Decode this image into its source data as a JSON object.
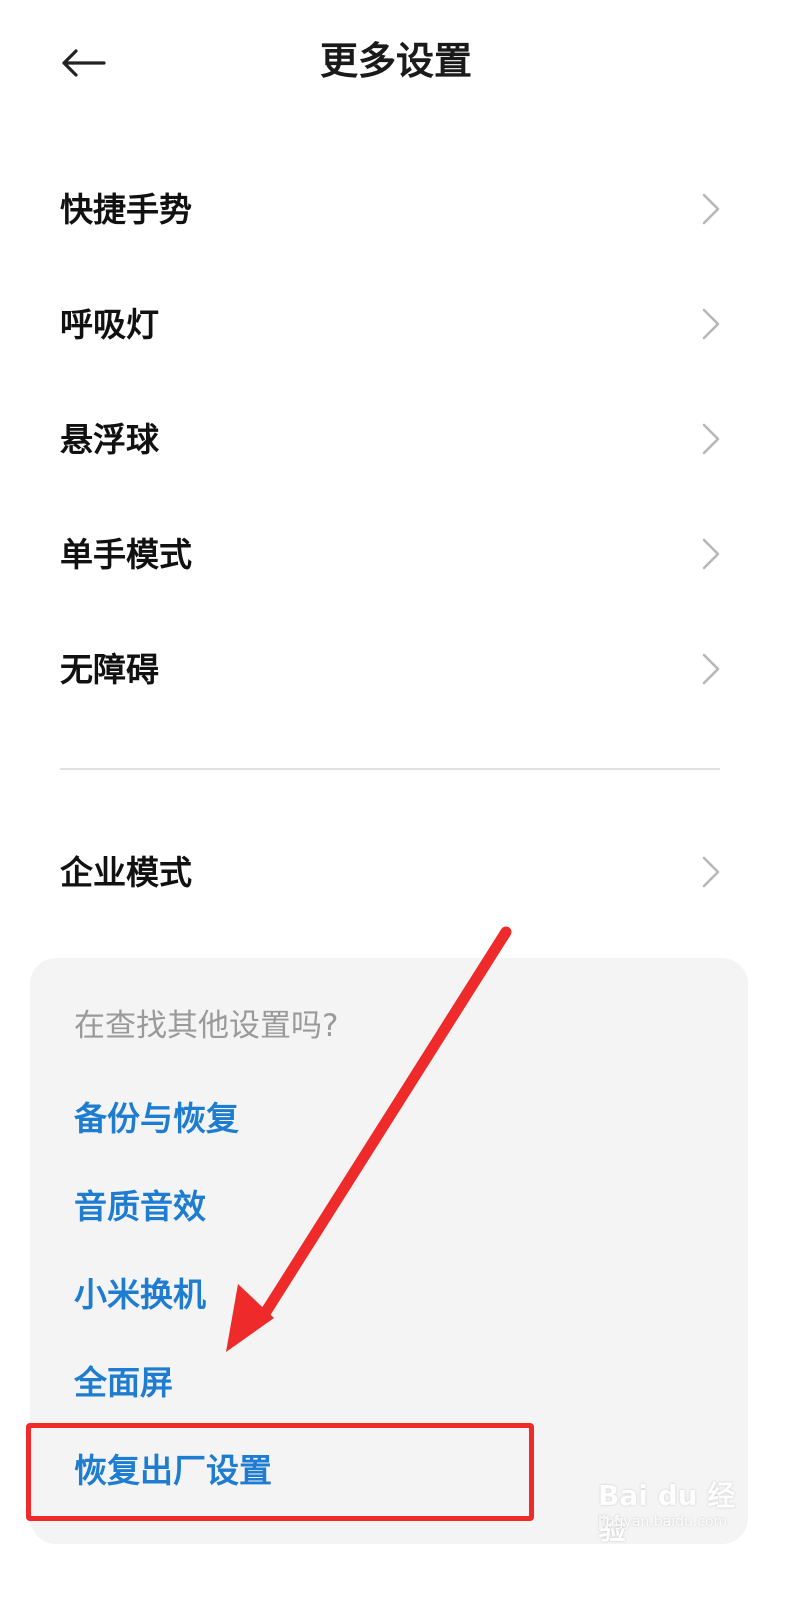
{
  "header": {
    "title": "更多设置",
    "back_icon": "arrow-left-icon"
  },
  "settings": {
    "items": [
      {
        "label": "快捷手势",
        "icon": "chevron-right-icon"
      },
      {
        "label": "呼吸灯",
        "icon": "chevron-right-icon"
      },
      {
        "label": "悬浮球",
        "icon": "chevron-right-icon"
      },
      {
        "label": "单手模式",
        "icon": "chevron-right-icon"
      },
      {
        "label": "无障碍",
        "icon": "chevron-right-icon"
      }
    ],
    "enterprise": {
      "label": "企业模式",
      "icon": "chevron-right-icon"
    }
  },
  "suggestions": {
    "heading": "在查找其他设置吗?",
    "links": [
      {
        "label": "备份与恢复"
      },
      {
        "label": "音质音效"
      },
      {
        "label": "小米换机"
      },
      {
        "label": "全面屏"
      },
      {
        "label": "恢复出厂设置"
      }
    ]
  },
  "annotation": {
    "highlight_color": "#ee2a2a",
    "arrow_color": "#ee2a2a"
  },
  "colors": {
    "link": "#1f7dd1",
    "muted": "#9a9a9a",
    "card_bg": "#f4f4f4"
  },
  "watermark": {
    "brand": "Bai du 经验",
    "sub": "jingyan.baidu.com"
  }
}
